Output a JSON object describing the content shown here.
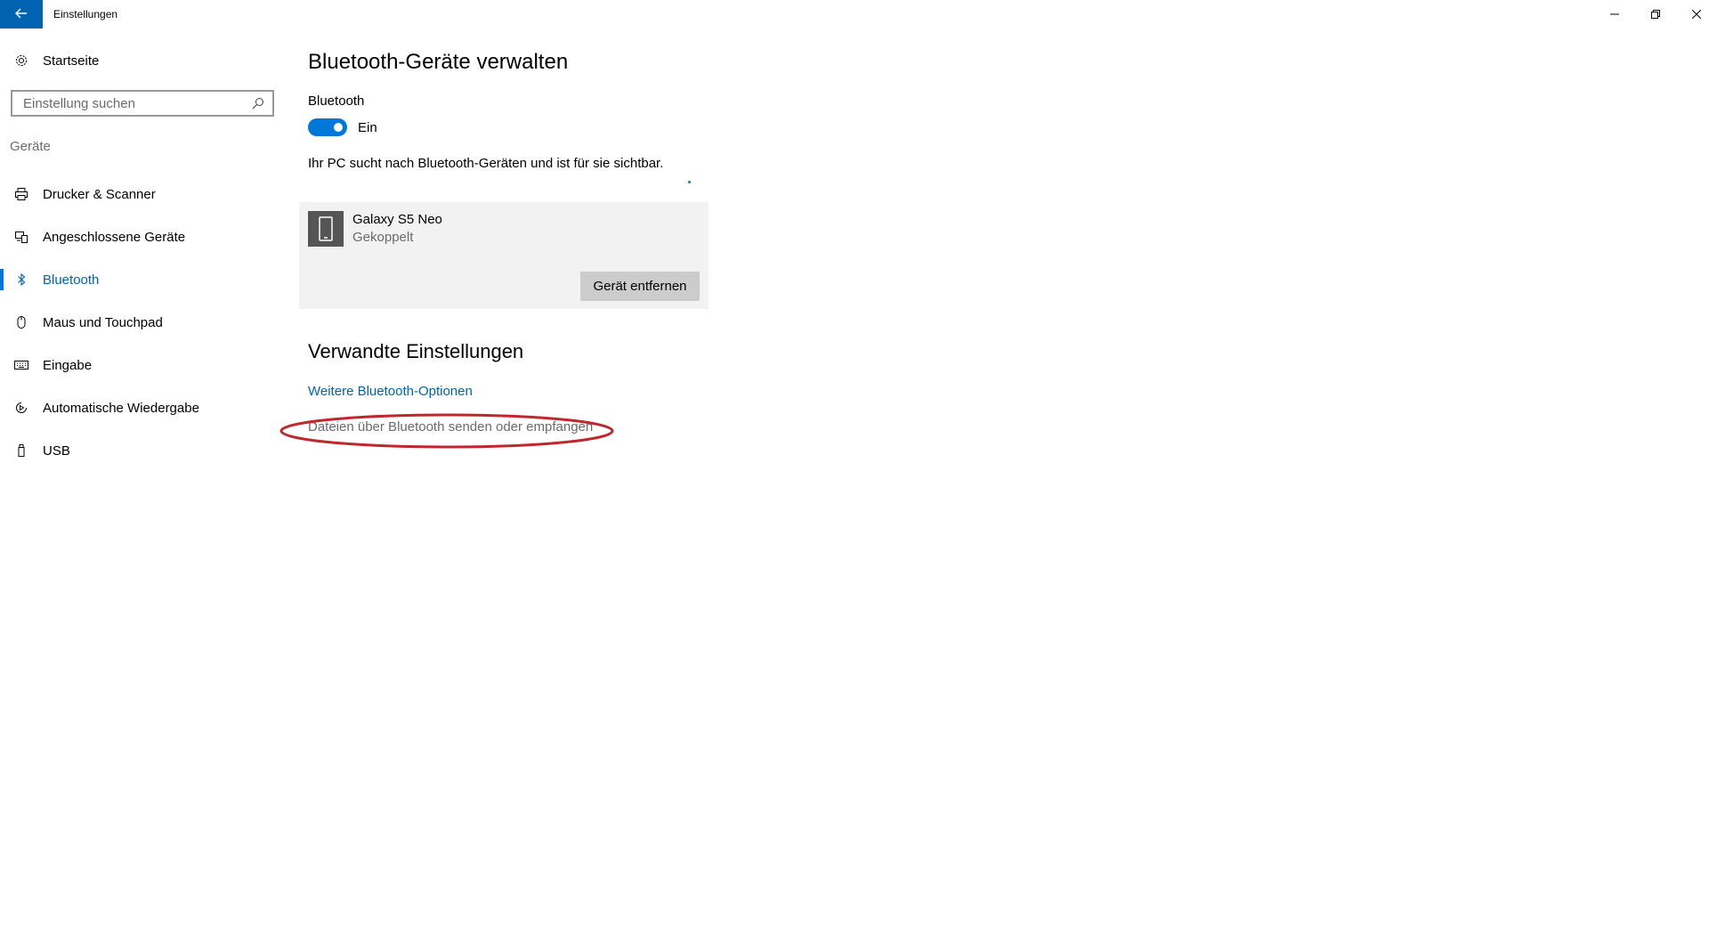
{
  "window": {
    "title": "Einstellungen",
    "back_icon": "arrow-left-icon",
    "minimize_glyph": "—",
    "maximize_glyph": "❐",
    "close_glyph": "✕"
  },
  "sidebar": {
    "home_label": "Startseite",
    "home_icon": "gear-icon",
    "search_placeholder": "Einstellung suchen",
    "section_label": "Geräte",
    "items": [
      {
        "label": "Drucker & Scanner",
        "icon": "printer-icon",
        "active": false
      },
      {
        "label": "Angeschlossene Geräte",
        "icon": "devices-icon",
        "active": false
      },
      {
        "label": "Bluetooth",
        "icon": "bluetooth-icon",
        "active": true
      },
      {
        "label": "Maus und Touchpad",
        "icon": "mouse-icon",
        "active": false
      },
      {
        "label": "Eingabe",
        "icon": "keyboard-icon",
        "active": false
      },
      {
        "label": "Automatische Wiedergabe",
        "icon": "autoplay-icon",
        "active": false
      },
      {
        "label": "USB",
        "icon": "usb-icon",
        "active": false
      }
    ]
  },
  "main": {
    "title": "Bluetooth-Geräte verwalten",
    "bluetooth_label": "Bluetooth",
    "toggle_state": "Ein",
    "toggle_on": true,
    "status_text": "Ihr PC sucht nach Bluetooth-Geräten und ist für sie sichtbar.",
    "device": {
      "name": "Galaxy S5 Neo",
      "status": "Gekoppelt",
      "icon": "phone-icon",
      "remove_label": "Gerät entfernen"
    },
    "related_title": "Verwandte Einstellungen",
    "links": [
      "Weitere Bluetooth-Optionen",
      "Dateien über Bluetooth senden oder empfangen"
    ]
  },
  "colors": {
    "accent": "#0078d7",
    "accent_dark": "#0063b1",
    "annotation": "#c0272d",
    "card_bg": "#f2f2f2"
  }
}
